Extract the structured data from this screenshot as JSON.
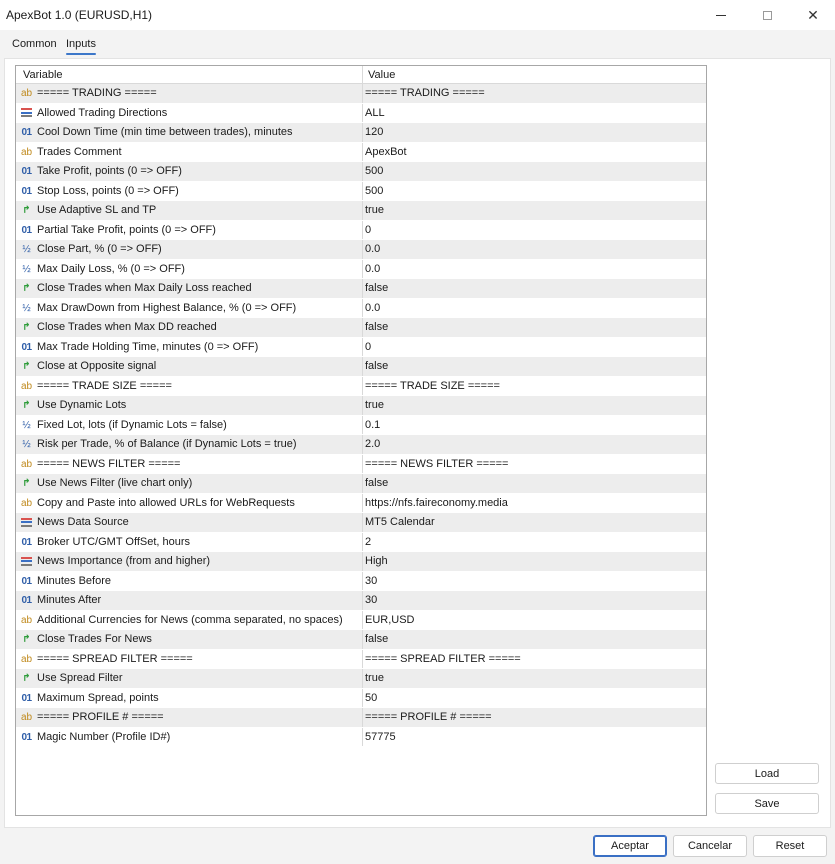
{
  "window": {
    "title": "ApexBot 1.0 (EURUSD,H1)",
    "close_glyph": "✕"
  },
  "tabs": [
    {
      "label": "Common",
      "active": false
    },
    {
      "label": "Inputs",
      "active": true
    }
  ],
  "grid": {
    "headers": {
      "variable": "Variable",
      "value": "Value"
    },
    "rows": [
      {
        "type": "string",
        "name": "===== TRADING =====",
        "value": "===== TRADING ====="
      },
      {
        "type": "enum",
        "name": "Allowed Trading Directions",
        "value": "ALL"
      },
      {
        "type": "int",
        "name": "Cool Down Time (min time between trades), minutes",
        "value": "120"
      },
      {
        "type": "string",
        "name": "Trades Comment",
        "value": "ApexBot"
      },
      {
        "type": "int",
        "name": "Take Profit, points (0 => OFF)",
        "value": "500"
      },
      {
        "type": "int",
        "name": "Stop Loss, points  (0 => OFF)",
        "value": "500"
      },
      {
        "type": "bool",
        "name": "Use Adaptive SL and TP",
        "value": "true"
      },
      {
        "type": "int",
        "name": "Partial Take Profit, points (0 => OFF)",
        "value": "0"
      },
      {
        "type": "double",
        "name": "Close Part, % (0 => OFF)",
        "value": "0.0"
      },
      {
        "type": "double",
        "name": "Max Daily Loss, % (0 => OFF)",
        "value": "0.0"
      },
      {
        "type": "bool",
        "name": "Close Trades when Max Daily Loss reached",
        "value": "false"
      },
      {
        "type": "double",
        "name": "Max DrawDown from Highest Balance, % (0 => OFF)",
        "value": "0.0"
      },
      {
        "type": "bool",
        "name": "Close Trades when Max DD reached",
        "value": "false"
      },
      {
        "type": "int",
        "name": "Max Trade Holding Time, minutes (0 => OFF)",
        "value": "0"
      },
      {
        "type": "bool",
        "name": "Close at Opposite signal",
        "value": "false"
      },
      {
        "type": "string",
        "name": "===== TRADE SIZE =====",
        "value": "===== TRADE SIZE ====="
      },
      {
        "type": "bool",
        "name": "Use Dynamic Lots",
        "value": "true"
      },
      {
        "type": "double",
        "name": "Fixed Lot, lots (if Dynamic Lots = false)",
        "value": "0.1"
      },
      {
        "type": "double",
        "name": "Risk per Trade, % of Balance (if Dynamic Lots = true)",
        "value": "2.0"
      },
      {
        "type": "string",
        "name": "===== NEWS FILTER =====",
        "value": "===== NEWS FILTER ====="
      },
      {
        "type": "bool",
        "name": "Use News Filter (live chart only)",
        "value": "false"
      },
      {
        "type": "string",
        "name": "Copy and Paste into allowed URLs for WebRequests",
        "value": "https://nfs.faireconomy.media"
      },
      {
        "type": "enum",
        "name": "News Data Source",
        "value": "MT5 Calendar"
      },
      {
        "type": "int",
        "name": "Broker UTC/GMT OffSet, hours",
        "value": "2"
      },
      {
        "type": "enum",
        "name": "News Importance (from and higher)",
        "value": "High"
      },
      {
        "type": "int",
        "name": "Minutes Before",
        "value": "30"
      },
      {
        "type": "int",
        "name": "Minutes After",
        "value": "30"
      },
      {
        "type": "string",
        "name": "Additional Currencies for News (comma separated, no spaces)",
        "value": "EUR,USD"
      },
      {
        "type": "bool",
        "name": "Close Trades For News",
        "value": "false"
      },
      {
        "type": "string",
        "name": "===== SPREAD FILTER =====",
        "value": "===== SPREAD FILTER ====="
      },
      {
        "type": "bool",
        "name": "Use Spread Filter",
        "value": "true"
      },
      {
        "type": "int",
        "name": "Maximum Spread, points",
        "value": "50"
      },
      {
        "type": "string",
        "name": "===== PROFILE # =====",
        "value": "===== PROFILE # ====="
      },
      {
        "type": "int",
        "name": "Magic Number (Profile ID#)",
        "value": "57775"
      }
    ]
  },
  "icons": {
    "string": {
      "name": "string-type-icon",
      "glyph": "ab"
    },
    "int": {
      "name": "integer-type-icon",
      "glyph": "01"
    },
    "double": {
      "name": "double-type-icon",
      "glyph": "½"
    },
    "bool": {
      "name": "boolean-type-icon",
      "glyph": "↱"
    },
    "enum": {
      "name": "enum-type-icon",
      "glyph": ""
    }
  },
  "side_buttons": {
    "load": "Load",
    "save": "Save"
  },
  "footer_buttons": {
    "ok": "Aceptar",
    "cancel": "Cancelar",
    "reset": "Reset"
  },
  "colors": {
    "enum_bar_top": "#d9534f",
    "enum_bar_mid": "#3a6fc4",
    "enum_bar_bot": "#7a7a7a"
  }
}
